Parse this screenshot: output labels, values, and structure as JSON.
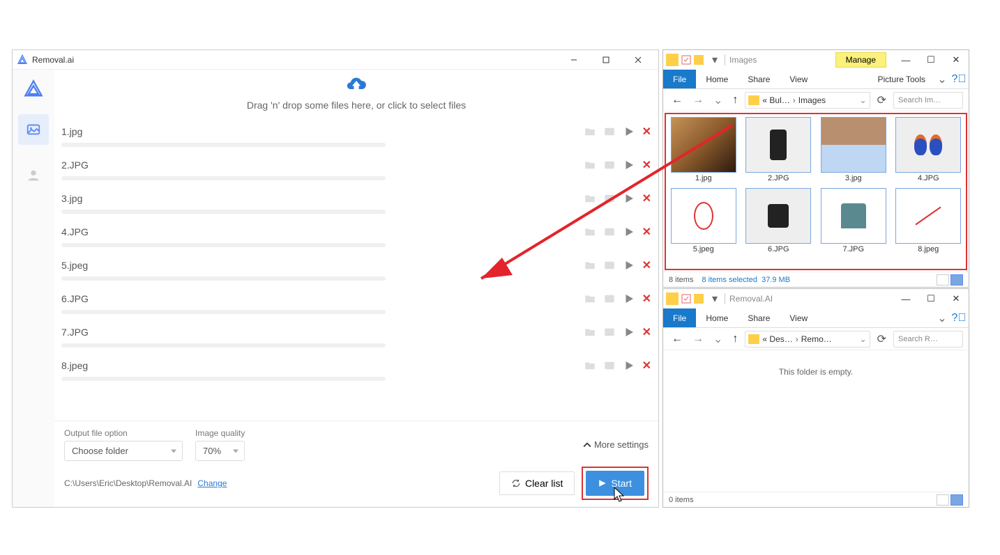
{
  "removal": {
    "title": "Removal.ai",
    "dropzone": "Drag 'n' drop some files here, or click to select files",
    "files": [
      "1.jpg",
      "2.JPG",
      "3.jpg",
      "4.JPG",
      "5.jpeg",
      "6.JPG",
      "7.JPG",
      "8.jpeg"
    ],
    "output_label": "Output file option",
    "output_value": "Choose folder",
    "quality_label": "Image quality",
    "quality_value": "70%",
    "more": "More settings",
    "path": "C:\\Users\\Eric\\Desktop\\Removal.AI",
    "change": "Change",
    "clear": "Clear list",
    "start": "Start"
  },
  "exp1": {
    "title": "Images",
    "manage": "Manage",
    "tabs": {
      "file": "File",
      "home": "Home",
      "share": "Share",
      "view": "View",
      "pictools": "Picture Tools"
    },
    "crumb1": "« Bul…",
    "crumb2": "Images",
    "search": "Search Im…",
    "thumbs": [
      "1.jpg",
      "2.JPG",
      "3.jpg",
      "4.JPG",
      "5.jpeg",
      "6.JPG",
      "7.JPG",
      "8.jpeg"
    ],
    "status_items": "8 items",
    "status_sel": "8 items selected",
    "status_size": "37.9 MB"
  },
  "exp2": {
    "title": "Removal.AI",
    "tabs": {
      "file": "File",
      "home": "Home",
      "share": "Share",
      "view": "View"
    },
    "crumb1": "« Des…",
    "crumb2": "Remo…",
    "search": "Search R…",
    "empty": "This folder is empty.",
    "status_items": "0 items"
  }
}
